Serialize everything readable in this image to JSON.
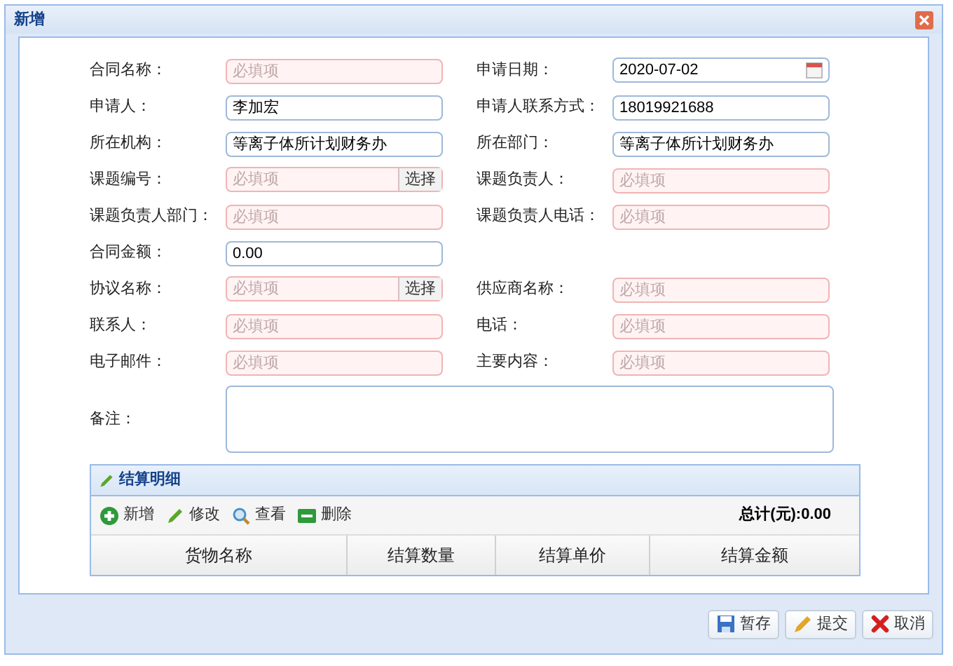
{
  "window": {
    "title": "新增"
  },
  "form": {
    "rows": [
      [
        {
          "label": "合同名称：",
          "kind": "text",
          "placeholder": "必填项",
          "required": true
        },
        {
          "label": "申请日期：",
          "kind": "date",
          "value": "2020-07-02",
          "required": false
        }
      ],
      [
        {
          "label": "申请人：",
          "kind": "text",
          "value": "李加宏",
          "required": false
        },
        {
          "label": "申请人联系方式：",
          "kind": "text",
          "value": "18019921688",
          "required": false
        }
      ],
      [
        {
          "label": "所在机构：",
          "kind": "text",
          "value": "等离子体所计划财务办",
          "required": false
        },
        {
          "label": "所在部门：",
          "kind": "text",
          "value": "等离子体所计划财务办",
          "required": false
        }
      ],
      [
        {
          "label": "课题编号：",
          "kind": "select",
          "placeholder": "必填项",
          "button": "选择",
          "required": true
        },
        {
          "label": "课题负责人：",
          "kind": "text",
          "placeholder": "必填项",
          "required": true
        }
      ],
      [
        {
          "label": "课题负责人部门：",
          "kind": "text",
          "placeholder": "必填项",
          "required": true
        },
        {
          "label": "课题负责人电话：",
          "kind": "text",
          "placeholder": "必填项",
          "required": true
        }
      ],
      [
        {
          "label": "合同金额：",
          "kind": "text",
          "value": "0.00",
          "required": false
        }
      ],
      [
        {
          "label": "协议名称：",
          "kind": "select",
          "placeholder": "必填项",
          "button": "选择",
          "required": true
        },
        {
          "label": "供应商名称：",
          "kind": "text",
          "placeholder": "必填项",
          "required": true
        }
      ],
      [
        {
          "label": "联系人：",
          "kind": "text",
          "placeholder": "必填项",
          "required": true
        },
        {
          "label": "电话：",
          "kind": "text",
          "placeholder": "必填项",
          "required": true
        }
      ],
      [
        {
          "label": "电子邮件：",
          "kind": "text",
          "placeholder": "必填项",
          "required": true
        },
        {
          "label": "主要内容：",
          "kind": "text",
          "placeholder": "必填项",
          "required": true
        }
      ]
    ],
    "remarks": {
      "label": "备注："
    }
  },
  "settlement": {
    "title": "结算明细",
    "toolbar": [
      {
        "kind": "add",
        "label": "新增"
      },
      {
        "kind": "edit",
        "label": "修改"
      },
      {
        "kind": "view",
        "label": "查看"
      },
      {
        "kind": "delete",
        "label": "删除"
      }
    ],
    "total": "总计(元):0.00",
    "columns": [
      "货物名称",
      "结算数量",
      "结算单价",
      "结算金额"
    ]
  },
  "buttons": [
    {
      "kind": "save",
      "label": "暂存"
    },
    {
      "kind": "submit",
      "label": "提交"
    },
    {
      "kind": "cancel",
      "label": "取消"
    }
  ]
}
